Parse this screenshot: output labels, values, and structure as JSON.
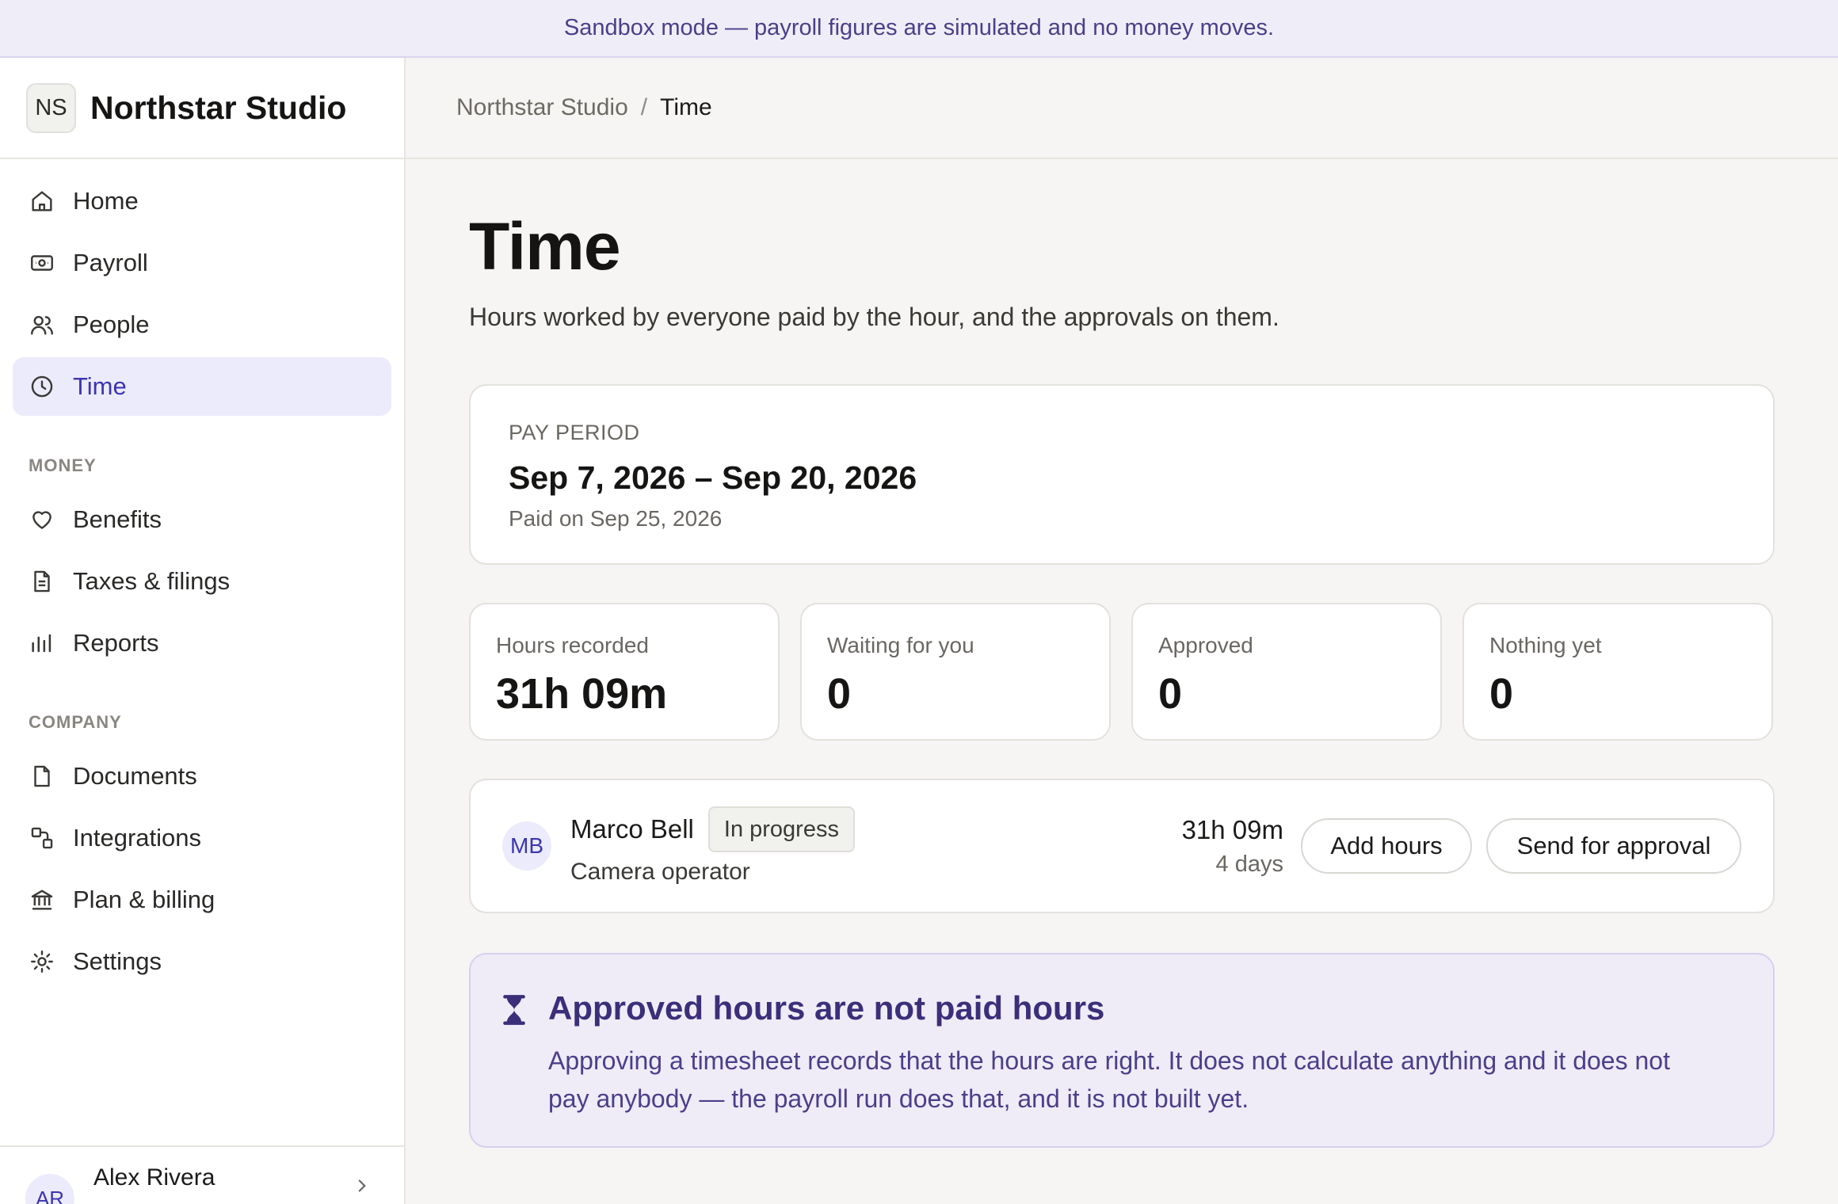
{
  "banner": {
    "text": "Sandbox mode — payroll figures are simulated and no money moves."
  },
  "brand": {
    "initials": "NS",
    "name": "Northstar Studio"
  },
  "sidebar": {
    "items": [
      {
        "label": "Home",
        "icon": "home-icon"
      },
      {
        "label": "Payroll",
        "icon": "payroll-icon"
      },
      {
        "label": "People",
        "icon": "people-icon"
      },
      {
        "label": "Time",
        "icon": "clock-icon",
        "active": true
      }
    ],
    "money_section": "MONEY",
    "money_items": [
      {
        "label": "Benefits",
        "icon": "heart-icon"
      },
      {
        "label": "Taxes & filings",
        "icon": "document-icon"
      },
      {
        "label": "Reports",
        "icon": "bar-chart-icon"
      }
    ],
    "company_section": "COMPANY",
    "company_items": [
      {
        "label": "Documents",
        "icon": "file-icon"
      },
      {
        "label": "Integrations",
        "icon": "integrations-icon"
      },
      {
        "label": "Plan & billing",
        "icon": "bank-icon"
      },
      {
        "label": "Settings",
        "icon": "settings-icon"
      }
    ],
    "user": {
      "initials": "AR",
      "name": "Alex Rivera"
    }
  },
  "breadcrumb": {
    "root": "Northstar Studio",
    "separator": "/",
    "current": "Time"
  },
  "page": {
    "title": "Time",
    "subtitle": "Hours worked by everyone paid by the hour, and the approvals on them."
  },
  "period": {
    "label": "PAY PERIOD",
    "range": "Sep 7, 2026 – Sep 20, 2026",
    "paid": "Paid on Sep 25, 2026"
  },
  "stats": [
    {
      "label": "Hours recorded",
      "value": "31h 09m"
    },
    {
      "label": "Waiting for you",
      "value": "0"
    },
    {
      "label": "Approved",
      "value": "0"
    },
    {
      "label": "Nothing yet",
      "value": "0"
    }
  ],
  "timesheet": {
    "initials": "MB",
    "name": "Marco Bell",
    "status": "In progress",
    "role": "Camera operator",
    "hours": "31h 09m",
    "days": "4 days",
    "add_label": "Add hours",
    "send_label": "Send for approval"
  },
  "notice": {
    "icon": "hourglass-icon",
    "title": "Approved hours are not paid hours",
    "text": "Approving a timesheet records that the hours are right. It does not calculate anything and it does not pay anybody — the payroll run does that, and it is not built yet."
  },
  "colors": {
    "accent": "#3d35b0",
    "accent_bg": "#ecebfb",
    "notice_bg": "#efecf8",
    "banner_bg": "#efedf7"
  }
}
